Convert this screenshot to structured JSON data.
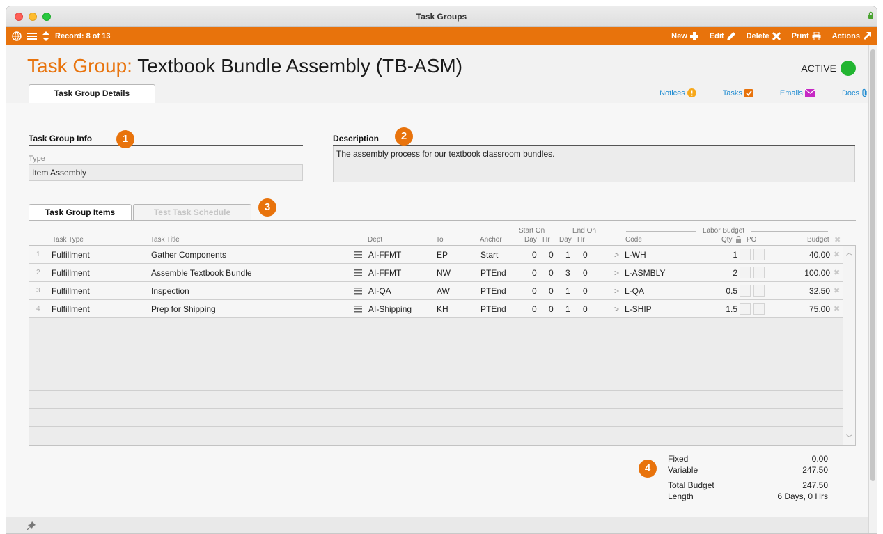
{
  "window": {
    "title": "Task Groups"
  },
  "toolbar": {
    "record_label": "Record: 8 of 13",
    "new_label": "New",
    "edit_label": "Edit",
    "delete_label": "Delete",
    "print_label": "Print",
    "actions_label": "Actions"
  },
  "header": {
    "title_prefix": "Task Group:",
    "title": "Textbook Bundle Assembly  (TB-ASM)",
    "status": "ACTIVE"
  },
  "tabs": {
    "main": "Task Group Details"
  },
  "side_links": [
    {
      "label": "Notices",
      "icon": "warning-icon"
    },
    {
      "label": "Tasks",
      "icon": "tasks-icon"
    },
    {
      "label": "Emails",
      "icon": "email-icon"
    },
    {
      "label": "Docs",
      "icon": "paperclip-icon"
    }
  ],
  "info": {
    "title": "Task Group Info",
    "badge": "1",
    "type_label": "Type",
    "type_value": "Item Assembly"
  },
  "description": {
    "title": "Description",
    "badge": "2",
    "text": "The assembly process for our textbook classroom bundles."
  },
  "subtabs": {
    "items": "Task Group Items",
    "schedule": "Test Task Schedule",
    "badge": "3"
  },
  "grid": {
    "group_headers": {
      "start_on": "Start On",
      "end_on": "End On",
      "labor_budget": "Labor Budget"
    },
    "columns": {
      "task_type": "Task Type",
      "task_title": "Task Title",
      "dept": "Dept",
      "to": "To",
      "anchor": "Anchor",
      "start_day": "Day",
      "start_hr": "Hr",
      "end_day": "Day",
      "end_hr": "Hr",
      "code": "Code",
      "qty": "Qty",
      "po": "PO",
      "budget": "Budget"
    },
    "rows": [
      {
        "num": "1",
        "task_type": "Fulfillment",
        "task_title": "Gather Components",
        "dept": "AI-FFMT",
        "to": "EP",
        "anchor": "Start",
        "start_day": "0",
        "start_hr": "0",
        "end_day": "1",
        "end_hr": "0",
        "code": "L-WH",
        "qty": "1",
        "budget": "40.00"
      },
      {
        "num": "2",
        "task_type": "Fulfillment",
        "task_title": "Assemble Textbook Bundle",
        "dept": "AI-FFMT",
        "to": "NW",
        "anchor": "PTEnd",
        "start_day": "0",
        "start_hr": "0",
        "end_day": "3",
        "end_hr": "0",
        "code": "L-ASMBLY",
        "qty": "2",
        "budget": "100.00"
      },
      {
        "num": "3",
        "task_type": "Fulfillment",
        "task_title": "Inspection",
        "dept": "AI-QA",
        "to": "AW",
        "anchor": "PTEnd",
        "start_day": "0",
        "start_hr": "0",
        "end_day": "1",
        "end_hr": "0",
        "code": "L-QA",
        "qty": "0.5",
        "budget": "32.50"
      },
      {
        "num": "4",
        "task_type": "Fulfillment",
        "task_title": "Prep for Shipping",
        "dept": "AI-Shipping",
        "to": "KH",
        "anchor": "PTEnd",
        "start_day": "0",
        "start_hr": "0",
        "end_day": "1",
        "end_hr": "0",
        "code": "L-SHIP",
        "qty": "1.5",
        "budget": "75.00"
      }
    ]
  },
  "summary": {
    "badge": "4",
    "fixed_label": "Fixed",
    "fixed_value": "0.00",
    "variable_label": "Variable",
    "variable_value": "247.50",
    "total_label": "Total Budget",
    "total_value": "247.50",
    "length_label": "Length",
    "length_value": "6 Days, 0 Hrs"
  },
  "colors": {
    "accent": "#e8730c",
    "active_green": "#22b531",
    "link": "#1e8bd1"
  }
}
